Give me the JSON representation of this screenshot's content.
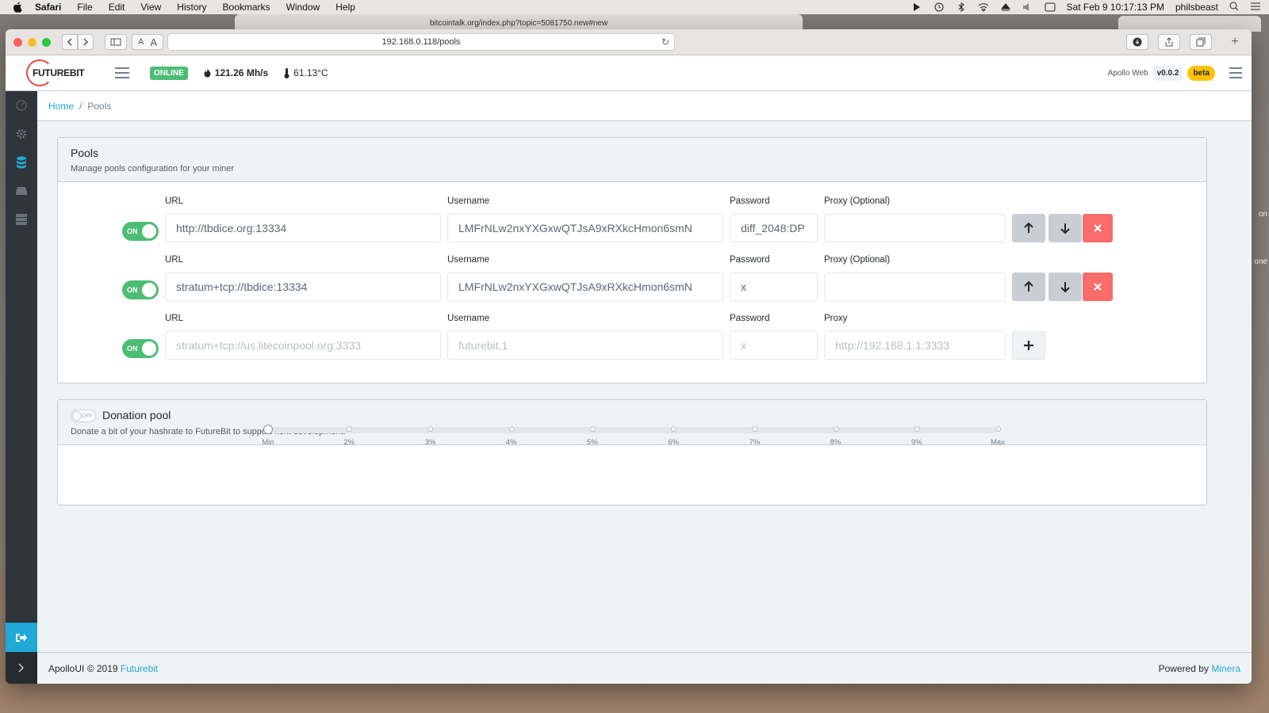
{
  "menubar": {
    "app": "Safari",
    "items": [
      "File",
      "Edit",
      "View",
      "History",
      "Bookmarks",
      "Window",
      "Help"
    ],
    "datetime": "Sat Feb 9  10:17:13 PM",
    "user": "philsbeast"
  },
  "background_tab": {
    "url": "bitcointalk.org/index.php?topic=5081750.new#new"
  },
  "peek": {
    "text1": "on",
    "text2": "one"
  },
  "browser": {
    "address": "192.168.0.118/pools"
  },
  "header": {
    "logo_text": "FUTUREBIT",
    "status": "ONLINE",
    "hashrate": "121.26 Mh/s",
    "temperature": "61.13°C",
    "app_name": "Apollo Web",
    "version": "v0.0.2",
    "beta": "beta"
  },
  "breadcrumb": {
    "home": "Home",
    "current": "Pools"
  },
  "pools_card": {
    "title": "Pools",
    "subtitle": "Manage pools configuration for your miner",
    "rows": [
      {
        "switch": "ON",
        "url_label": "URL",
        "url": "http://tbdice.org:13334",
        "user_label": "Username",
        "user": "LMFrNLw2nxYXGxwQTJsA9xRXkcHmon6smN",
        "pass_label": "Password",
        "pass": "diff_2048:DP",
        "proxy_label": "Proxy (Optional)",
        "proxy": ""
      },
      {
        "switch": "ON",
        "url_label": "URL",
        "url": "stratum+tcp://tbdice:13334",
        "user_label": "Username",
        "user": "LMFrNLw2nxYXGxwQTJsA9xRXkcHmon6smN",
        "pass_label": "Password",
        "pass": "x",
        "proxy_label": "Proxy (Optional)",
        "proxy": ""
      },
      {
        "switch": "ON",
        "url_label": "URL",
        "url_ph": "stratum+tcp://us.litecoinpool.org:3333",
        "user_label": "Username",
        "user_ph": "futurebit.1",
        "pass_label": "Password",
        "pass_ph": "x",
        "proxy_label": "Proxy",
        "proxy_ph": "http://192.168.1.1:3333"
      }
    ]
  },
  "donation_card": {
    "switch": "OFF",
    "title": "Donation pool",
    "subtitle": "Donate a bit of your hashrate to FutureBit to support next development.",
    "value": "Min",
    "ticks": [
      "Min",
      "2%",
      "3%",
      "4%",
      "5%",
      "6%",
      "7%",
      "8%",
      "9%",
      "Max"
    ]
  },
  "footer": {
    "left_prefix": "ApolloUI © 2019",
    "left_link": "Futurebit",
    "right_prefix": "Powered by",
    "right_link": "Minera"
  },
  "colors": {
    "primary": "#20a8d8",
    "success": "#4dbd74",
    "danger": "#f86c6b",
    "warning": "#ffc107",
    "sidebar": "#2f353a"
  }
}
